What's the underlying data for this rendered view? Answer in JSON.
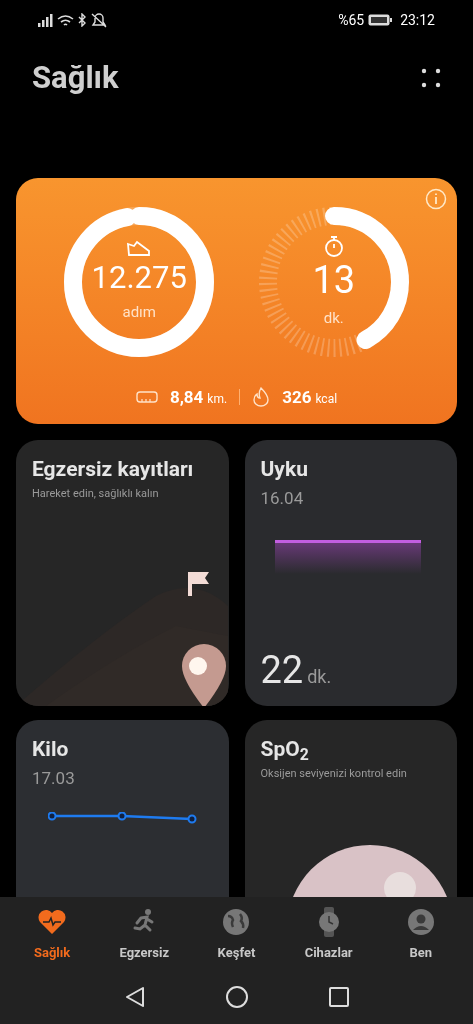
{
  "status_bar": {
    "battery": "%65",
    "time": "23:12"
  },
  "header": {
    "title": "Sağlık"
  },
  "activity": {
    "steps": {
      "value": "12.275",
      "unit": "adım"
    },
    "minutes": {
      "value": "13",
      "unit": "dk."
    },
    "distance": {
      "value": "8,84",
      "unit": "km."
    },
    "calories": {
      "value": "326",
      "unit": "kcal"
    }
  },
  "cards": [
    {
      "kind": "exercise",
      "title": "Egzersiz kayıtları",
      "subtitle": "Hareket edin, sağlıklı kalın"
    },
    {
      "kind": "sleep",
      "title": "Uyku",
      "date": "16.04",
      "value": "22",
      "unit": "dk."
    },
    {
      "kind": "weight",
      "title": "Kilo",
      "date": "17.03"
    },
    {
      "kind": "spo2",
      "title": "SpO$_{2}$",
      "subtitle": "Oksijen seviyenizi kontrol edin"
    }
  ],
  "tabs": [
    {
      "label": "Sağlık",
      "selected": true
    },
    {
      "label": "Egzersiz",
      "selected": false
    },
    {
      "label": "Keşfet",
      "selected": false
    },
    {
      "label": "Cihazlar",
      "selected": false
    },
    {
      "label": "Ben",
      "selected": false
    }
  ]
}
